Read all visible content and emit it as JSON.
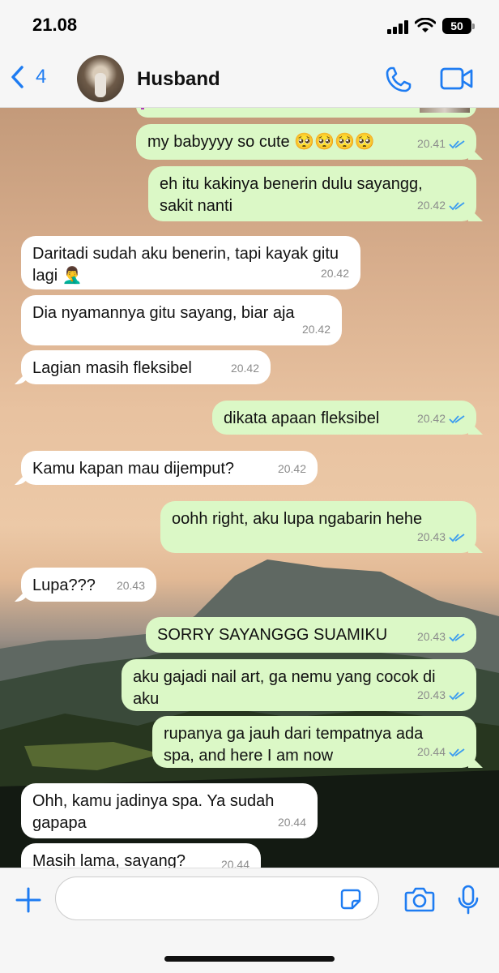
{
  "status": {
    "time": "21.08",
    "battery": "50"
  },
  "nav": {
    "back_count": "4",
    "contact": "Husband"
  },
  "messages": [
    {
      "dir": "out",
      "text": "my babyyyy so cute 🥺🥺🥺🥺",
      "time": "20.41",
      "read": true
    },
    {
      "dir": "out",
      "text": "eh itu kakinya benerin dulu sayangg, sakit nanti",
      "time": "20.42",
      "read": true
    },
    {
      "dir": "in",
      "text": "Daritadi sudah aku benerin, tapi kayak gitu lagi 🤦‍♂️",
      "time": "20.42"
    },
    {
      "dir": "in",
      "text": "Dia nyamannya gitu sayang, biar aja",
      "time": "20.42"
    },
    {
      "dir": "in",
      "text": "Lagian masih fleksibel",
      "time": "20.42"
    },
    {
      "dir": "out",
      "text": "dikata apaan fleksibel",
      "time": "20.42",
      "read": true
    },
    {
      "dir": "in",
      "text": "Kamu kapan mau dijemput?",
      "time": "20.42"
    },
    {
      "dir": "out",
      "text": "oohh right, aku lupa ngabarin hehe",
      "time": "20.43",
      "read": true
    },
    {
      "dir": "in",
      "text": "Lupa???",
      "time": "20.43"
    },
    {
      "dir": "out",
      "text": "SORRY SAYANGGG SUAMIKU",
      "time": "20.43",
      "read": true
    },
    {
      "dir": "out",
      "text": "aku gajadi nail art, ga nemu yang cocok di aku",
      "time": "20.43",
      "read": true
    },
    {
      "dir": "out",
      "text": "rupanya ga jauh dari tempatnya ada spa, and here I am now",
      "time": "20.44",
      "read": true
    },
    {
      "dir": "in",
      "text": "Ohh, kamu jadinya spa. Ya sudah gapapa",
      "time": "20.44"
    },
    {
      "dir": "in",
      "text": "Masih lama, sayang?",
      "time": "20.44"
    }
  ],
  "composer": {
    "placeholder": ""
  },
  "colors": {
    "accent": "#1e7cf2",
    "outgoing": "#dbf8c6",
    "incoming": "#ffffff",
    "read_tick": "#3b9cf0"
  }
}
